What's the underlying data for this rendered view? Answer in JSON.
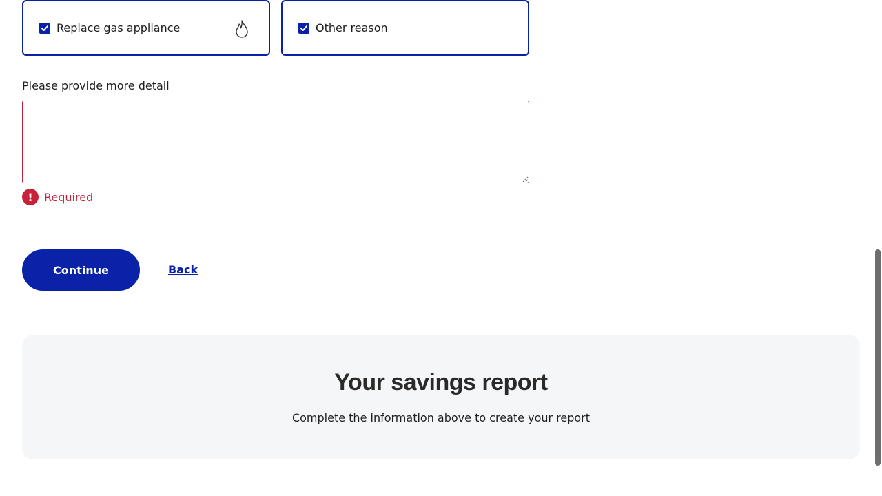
{
  "options": [
    {
      "label": "Replace gas appliance",
      "checked": true,
      "icon": "flame-icon"
    },
    {
      "label": "Other reason",
      "checked": true
    }
  ],
  "detail": {
    "label": "Please provide more detail",
    "value": "",
    "error": "Required"
  },
  "actions": {
    "continue_label": "Continue",
    "back_label": "Back"
  },
  "report": {
    "title": "Your savings report",
    "subtitle": "Complete the information above to create your report"
  },
  "colors": {
    "primary": "#0a22a8",
    "error": "#c3213a",
    "panel_bg": "#f5f6f8"
  }
}
